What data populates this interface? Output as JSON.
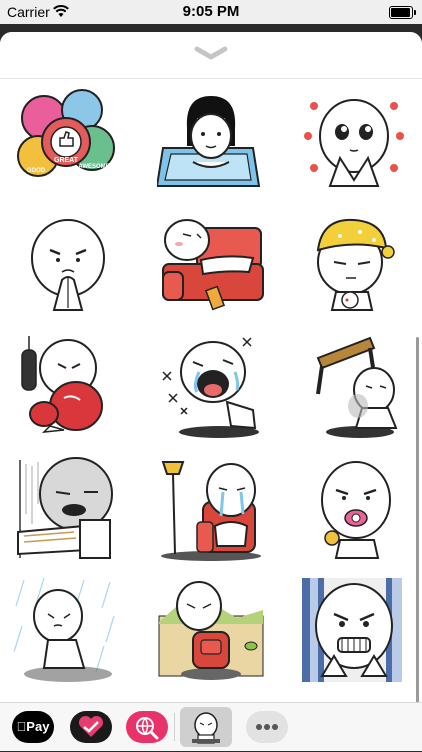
{
  "status_bar": {
    "carrier": "Carrier",
    "time": "9:05 PM"
  },
  "sticker_pack": {
    "stickers": [
      {
        "id": "thumbs-up-badges",
        "badge_texts": [
          "GOOD",
          "GREAT",
          "AWESOME"
        ]
      },
      {
        "id": "girl-on-tablet"
      },
      {
        "id": "sparkly-eyes"
      },
      {
        "id": "praying-hands"
      },
      {
        "id": "lying-on-couch"
      },
      {
        "id": "sleepy-nightcap"
      },
      {
        "id": "boxing-glove"
      },
      {
        "id": "laughing-floor"
      },
      {
        "id": "table-flip"
      },
      {
        "id": "writing-desk"
      },
      {
        "id": "crying-armchair"
      },
      {
        "id": "pacifier-baby"
      },
      {
        "id": "rain-walk"
      },
      {
        "id": "backpack-field"
      },
      {
        "id": "scared-stripes"
      }
    ]
  },
  "app_tray": {
    "apple_pay_label": "Pay",
    "apps": [
      "apple-pay",
      "heart-app",
      "search-app",
      "sticker-pack",
      "more-apps"
    ]
  }
}
